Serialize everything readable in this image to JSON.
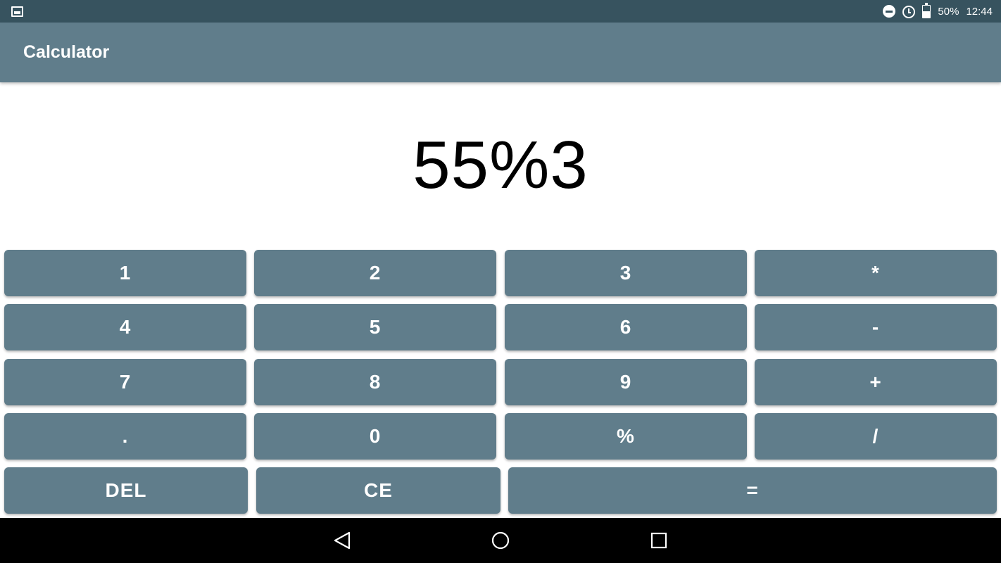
{
  "status_bar": {
    "left_icon": "image-icon",
    "icons": [
      "do-not-disturb-icon",
      "alarm-icon",
      "battery-icon"
    ],
    "battery": "50%",
    "time": "12:44"
  },
  "app_bar": {
    "title": "Calculator"
  },
  "display": {
    "expression": "55%3"
  },
  "keys": {
    "one": "1",
    "two": "2",
    "three": "3",
    "multiply": "*",
    "four": "4",
    "five": "5",
    "six": "6",
    "minus": "-",
    "seven": "7",
    "eight": "8",
    "nine": "9",
    "plus": "+",
    "dot": ".",
    "zero": "0",
    "percent": "%",
    "divide": "/",
    "del": "DEL",
    "ce": "CE",
    "equals": "="
  },
  "nav_bar": {
    "icons": [
      "back-icon",
      "home-icon",
      "recents-icon"
    ]
  },
  "colors": {
    "status_bar": "#37535f",
    "primary": "#607d8b",
    "key_text": "#ffffff",
    "display_text": "#000000",
    "nav_bar": "#000000"
  }
}
